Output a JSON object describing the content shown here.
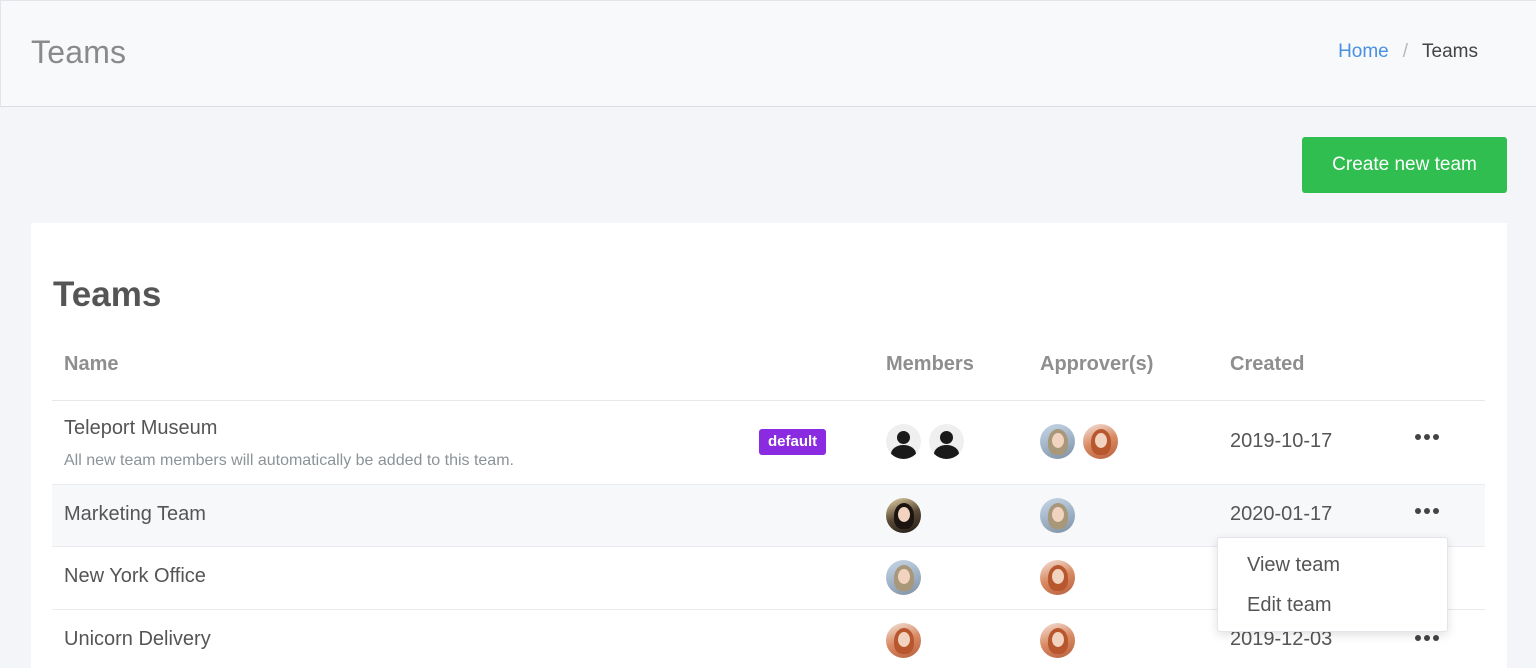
{
  "header": {
    "title": "Teams",
    "breadcrumb": {
      "home": "Home",
      "separator": "/",
      "current": "Teams"
    }
  },
  "actions": {
    "create_label": "Create new team"
  },
  "card": {
    "title": "Teams",
    "columns": {
      "name": "Name",
      "members": "Members",
      "approvers": "Approver(s)",
      "created": "Created"
    },
    "rows": [
      {
        "name": "Teleport Museum",
        "description": "All new team members will automatically be added to this team.",
        "badge": "default",
        "members": [
          "user-placeholder-icon",
          "user-placeholder-icon"
        ],
        "approvers": [
          "avatar-blonde",
          "avatar-redhead"
        ],
        "created": "2019-10-17"
      },
      {
        "name": "Marketing Team",
        "members": [
          "avatar-dark-hair"
        ],
        "approvers": [
          "avatar-blonde"
        ],
        "created": "2020-01-17"
      },
      {
        "name": "New York Office",
        "members": [
          "avatar-blonde"
        ],
        "approvers": [
          "avatar-redhead"
        ],
        "created": ""
      },
      {
        "name": "Unicorn Delivery",
        "members": [
          "avatar-redhead"
        ],
        "approvers": [
          "avatar-redhead"
        ],
        "created": "2019-12-03"
      }
    ]
  },
  "dropdown": {
    "view": "View team",
    "edit": "Edit team"
  },
  "colors": {
    "accent_green": "#2fbe4f",
    "badge_purple": "#8a2be2",
    "link_blue": "#4a90e2"
  }
}
